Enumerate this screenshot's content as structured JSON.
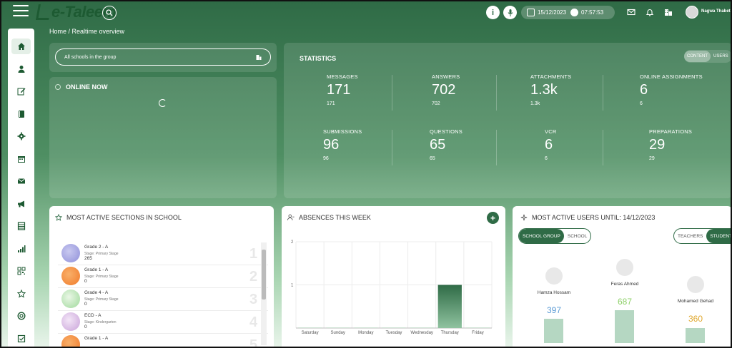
{
  "header": {
    "logo_text": "e-Taleem",
    "date": "15/12/2023",
    "time": "07:57:53",
    "user_name": "Nagwa Thabet"
  },
  "breadcrumb": "Home / Realtime overview",
  "school_filter": {
    "value": "All schools in the group"
  },
  "online_now": {
    "title": "ONLINE NOW"
  },
  "statistics": {
    "title": "STATISTICS",
    "toggle": [
      "CONTENT",
      "USERS"
    ],
    "items": [
      {
        "label": "MESSAGES",
        "value": "171",
        "sub": "171"
      },
      {
        "label": "ANSWERS",
        "value": "702",
        "sub": "702"
      },
      {
        "label": "ATTACHMENTS",
        "value": "1.3k",
        "sub": "1.3k"
      },
      {
        "label": "ONLINE ASSIGNMENTS",
        "value": "6",
        "sub": "6"
      },
      {
        "label": "SUBMISSIONS",
        "value": "96",
        "sub": "96"
      },
      {
        "label": "QUESTIONS",
        "value": "65",
        "sub": "65"
      },
      {
        "label": "VCR",
        "value": "6",
        "sub": "6"
      },
      {
        "label": "PREPARATIONS",
        "value": "29",
        "sub": "29"
      }
    ]
  },
  "active_sections": {
    "title": "MOST ACTIVE SECTIONS IN SCHOOL",
    "rows": [
      {
        "name": "Grade 2 - A",
        "stage": "Stage: Primary Stage",
        "count": "265",
        "rank": "1",
        "color": "#8f8fd9"
      },
      {
        "name": "Grade 1 - A",
        "stage": "Stage: Primary Stage",
        "count": "0",
        "rank": "2",
        "color": "#f07a2a"
      },
      {
        "name": "Grade 4 - A",
        "stage": "Stage: Primary Stage",
        "count": "0",
        "rank": "3",
        "color": "#9ed89a"
      },
      {
        "name": "ECD - A",
        "stage": "Stage: Kindergarten",
        "count": "0",
        "rank": "4",
        "color": "#c9a3d9"
      },
      {
        "name": "Grade 1 - A",
        "stage": "",
        "count": "",
        "rank": "5",
        "color": "#f07a2a"
      }
    ]
  },
  "absences": {
    "title": "ABSENCES THIS WEEK",
    "chart_data": {
      "type": "bar",
      "categories": [
        "Saturday",
        "Sunday",
        "Monday",
        "Tuesday",
        "Wednesday",
        "Thursday",
        "Friday"
      ],
      "values": [
        0,
        0,
        0,
        0,
        0,
        1,
        0
      ],
      "yticks": [
        "1",
        "2"
      ],
      "ylim": [
        0,
        2
      ],
      "bar_color": "#2f6b46"
    }
  },
  "active_users": {
    "title": "MOST ACTIVE USERS UNTIL: 14/12/2023",
    "scope_toggle": [
      "SCHOOL GROUP",
      "SCHOOL"
    ],
    "role_toggle": [
      "TEACHERS",
      "STUDENTS"
    ],
    "users": [
      {
        "name": "Hamza Hossam",
        "score": "397",
        "color": "#5b9bd5"
      },
      {
        "name": "Feras Ahmed",
        "score": "687",
        "color": "#8fd16a"
      },
      {
        "name": "Mohamed Gehad",
        "score": "360",
        "color": "#e0a82e"
      }
    ]
  }
}
